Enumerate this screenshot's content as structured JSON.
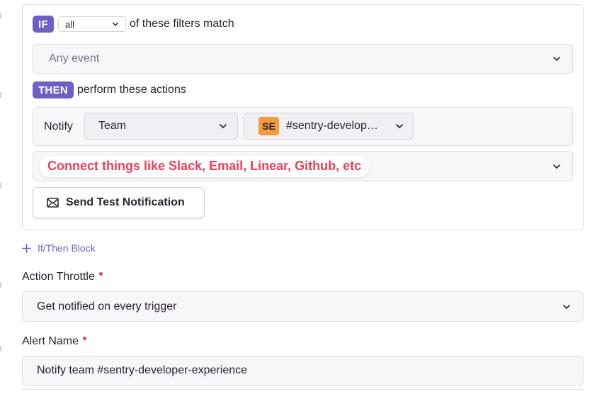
{
  "filters": {
    "if_badge": "IF",
    "match_mode": "all",
    "match_suffix": "of these filters match",
    "event_placeholder": "Any event"
  },
  "actions": {
    "then_badge": "THEN",
    "then_suffix": "perform these actions",
    "notify_label": "Notify",
    "target_type": "Team",
    "channel_avatar": "SE",
    "channel_name": "#sentry-develop…",
    "connect_hint": "Connect things like Slack, Email, Linear, Github, etc",
    "test_button": "Send Test Notification"
  },
  "add_block_label": "If/Then Block",
  "throttle": {
    "label": "Action Throttle",
    "value": "Get notified on every trigger"
  },
  "alert_name": {
    "label": "Alert Name",
    "value": "Notify team #sentry-developer-experience"
  },
  "colors": {
    "accent": "#6c5fc7",
    "required": "#f23e55",
    "avatar": "#f59a3b"
  }
}
